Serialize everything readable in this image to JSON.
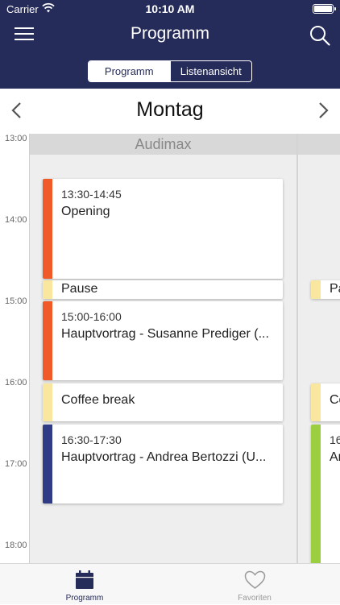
{
  "status": {
    "carrier": "Carrier",
    "time": "10:10 AM"
  },
  "header": {
    "title": "Programm"
  },
  "segments": {
    "active": "Programm",
    "inactive": "Listenansicht"
  },
  "day": {
    "name": "Montag"
  },
  "hours": [
    "13:00",
    "14:00",
    "15:00",
    "16:00",
    "17:00",
    "18:00"
  ],
  "columns": [
    {
      "name": "Audimax"
    }
  ],
  "events": [
    {
      "time": "13:30-14:45",
      "title": "Opening",
      "color": "#f05a28"
    },
    {
      "time": "",
      "title": "Pause",
      "color": "#f9e79f"
    },
    {
      "time": "15:00-16:00",
      "title": "Hauptvortrag - Susanne Prediger (...",
      "color": "#f05a28"
    },
    {
      "time": "",
      "title": "Coffee break",
      "color": "#f9e79f"
    },
    {
      "time": "16:30-17:30",
      "title": "Hauptvortrag - Andrea Bertozzi (U...",
      "color": "#2f3b84"
    }
  ],
  "second_column_peek": [
    {
      "time": "",
      "title": "Pa",
      "color": "#f9e79f"
    },
    {
      "time": "",
      "title": "Co",
      "color": "#f9e79f"
    },
    {
      "time": "16",
      "title": "An",
      "color": "#9ccf3f"
    }
  ],
  "tabs": [
    {
      "label": "Programm",
      "icon": "calendar-icon",
      "active": true,
      "color": "#262c5a"
    },
    {
      "label": "Favoriten",
      "icon": "heart-icon",
      "active": false,
      "color": "#9a9a9a"
    }
  ]
}
